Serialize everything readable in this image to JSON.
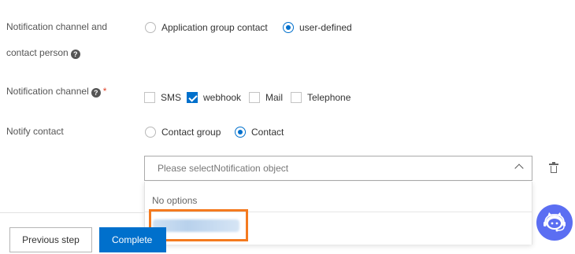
{
  "form": {
    "channel_contact": {
      "label_line1": "Notification channel and",
      "label_line2": "contact person",
      "options": [
        "Application group contact",
        "user-defined"
      ],
      "selected": "user-defined"
    },
    "notification_channel": {
      "label": "Notification channel",
      "required_mark": "*",
      "options": [
        {
          "label": "SMS",
          "checked": false
        },
        {
          "label": "webhook",
          "checked": true
        },
        {
          "label": "Mail",
          "checked": false
        },
        {
          "label": "Telephone",
          "checked": false
        }
      ]
    },
    "notify_contact": {
      "label": "Notify contact",
      "options": [
        "Contact group",
        "Contact"
      ],
      "selected": "Contact"
    },
    "select": {
      "placeholder": "Please selectNotification object",
      "no_options": "No options"
    }
  },
  "footer": {
    "previous_label": "Previous step",
    "complete_label": "Complete"
  },
  "icons": {
    "help": "help-icon",
    "chevron": "chevron-up-icon",
    "delete": "trash-icon",
    "assistant": "assistant-bot-icon"
  },
  "colors": {
    "accent": "#0070cc",
    "highlight": "#f47a1f",
    "assistant": "#5b6ef2"
  }
}
